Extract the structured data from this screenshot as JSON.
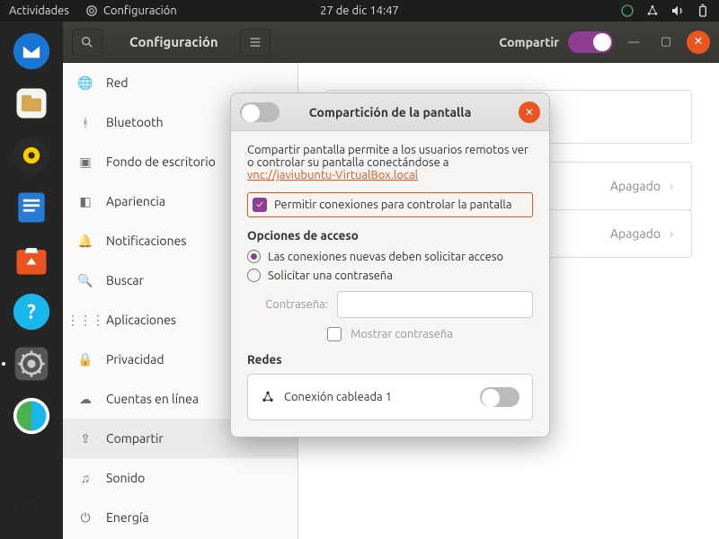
{
  "topbar": {
    "activities": "Actividades",
    "app_name": "Configuración",
    "datetime": "27 de dic  14:47"
  },
  "window": {
    "title": "Configuración",
    "share_label": "Compartir"
  },
  "sidebar": {
    "items": [
      {
        "label": "Red"
      },
      {
        "label": "Bluetooth"
      },
      {
        "label": "Fondo de escritorio"
      },
      {
        "label": "Apariencia"
      },
      {
        "label": "Notificaciones"
      },
      {
        "label": "Buscar"
      },
      {
        "label": "Aplicaciones"
      },
      {
        "label": "Privacidad"
      },
      {
        "label": "Cuentas en línea"
      },
      {
        "label": "Compartir"
      },
      {
        "label": "Sonido"
      },
      {
        "label": "Energía"
      }
    ]
  },
  "content": {
    "row1_status": "Apagado",
    "row2_status": "Apagado"
  },
  "modal": {
    "title": "Compartición de la pantalla",
    "description_prefix": "Compartir pantalla permite a los usuarios remotos ver o controlar su pantalla conectándose a ",
    "vnc_url": "vnc://javiubuntu-VirtualBox.local",
    "allow_control": "Permitir conexiones para controlar la pantalla",
    "access_options": "Opciones de acceso",
    "radio_request": "Las conexiones nuevas deben solicitar acceso",
    "radio_password": "Solicitar una contraseña",
    "password_label": "Contraseña:",
    "show_password": "Mostrar contraseña",
    "networks": "Redes",
    "network_name": "Conexión cableada 1"
  }
}
